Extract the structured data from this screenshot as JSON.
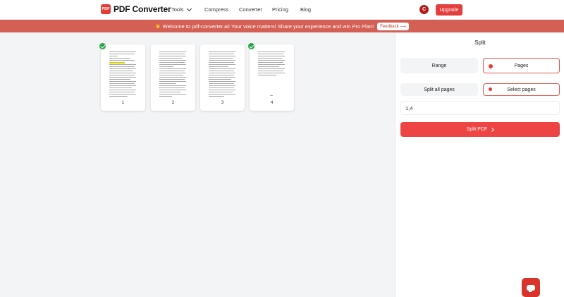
{
  "header": {
    "logo_badge": "PDF",
    "logo_text": "PDF Converter",
    "nav": {
      "tools": "Tools",
      "compress": "Compress",
      "converter": "Converter",
      "pricing": "Pricing",
      "blog": "Blog"
    },
    "avatar_initial": "C",
    "upgrade_label": "Upgrade"
  },
  "banner": {
    "icon": "👋",
    "text": "Welcome to pdf-converter.ai! Your voice matters! Share your experience and win Pro Plan!",
    "feedback_label": "Feedback ⟶"
  },
  "pages": [
    {
      "number": "1",
      "checked": true
    },
    {
      "number": "2",
      "checked": false
    },
    {
      "number": "3",
      "checked": false
    },
    {
      "number": "4",
      "checked": true
    }
  ],
  "panel": {
    "title": "Split",
    "mode_range": "Range",
    "mode_pages": "Pages",
    "split_all": "Split all pages",
    "select_pages": "Select pages",
    "pages_value": "1,4",
    "split_button": "Split PDF"
  },
  "colors": {
    "brand_red": "#e53935",
    "banner": "#d45f55",
    "check_green": "#22a34a"
  }
}
